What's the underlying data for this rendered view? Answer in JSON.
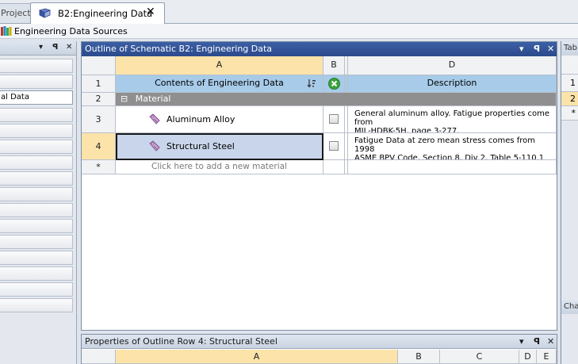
{
  "tabs": {
    "project_label": "Project",
    "active_label": "B2:Engineering Data",
    "close_glyph": "✕"
  },
  "toolbar": {
    "sources_label": "Engineering Data Sources"
  },
  "left_panel": {
    "controls": [
      "▾",
      "ꟼ",
      "✕"
    ],
    "items": [
      "",
      "",
      "al Data",
      "",
      "",
      "",
      "",
      "",
      "",
      "",
      "",
      "",
      "",
      "",
      "",
      ""
    ]
  },
  "outline": {
    "title": "Outline of Schematic B2: Engineering Data",
    "controls": [
      "▾",
      "ꟼ",
      "✕"
    ],
    "columns": {
      "A": "A",
      "B": "B",
      "D": "D"
    },
    "header_row": {
      "num": "1",
      "contents": "Contents of Engineering Data",
      "description": "Description"
    },
    "group_row": {
      "num": "2",
      "expand": "⊟",
      "label": "Material"
    },
    "materials": [
      {
        "num": "3",
        "name": "Aluminum Alloy",
        "desc_line1": "General aluminum alloy. Fatigue properties come from",
        "desc_line2": "MIL-HDBK-5H, page 3-277."
      },
      {
        "num": "4",
        "name": "Structural Steel",
        "desc_line1": "Fatigue Data at zero mean stress comes from 1998",
        "desc_line2": "ASME BPV Code, Section 8, Div 2, Table 5-110.1"
      }
    ],
    "new_row": {
      "num": "*",
      "placeholder": "Click here to add a new material"
    }
  },
  "right_panel": {
    "title_top": "Tab",
    "rows": [
      "1",
      "2",
      "*"
    ],
    "title_bottom": "Cha"
  },
  "properties": {
    "title": "Properties of Outline Row 4: Structural Steel",
    "controls": [
      "▾",
      "ꟼ",
      "✕"
    ],
    "columns": [
      "A",
      "B",
      "C",
      "D",
      "E"
    ]
  },
  "colors": {
    "title_blue": "#2c4a8c",
    "selected_orange": "#fbe3a9",
    "header_blue": "#a7cbe8",
    "group_gray": "#8f8f8f",
    "selected_cell": "#c8d5ea"
  }
}
